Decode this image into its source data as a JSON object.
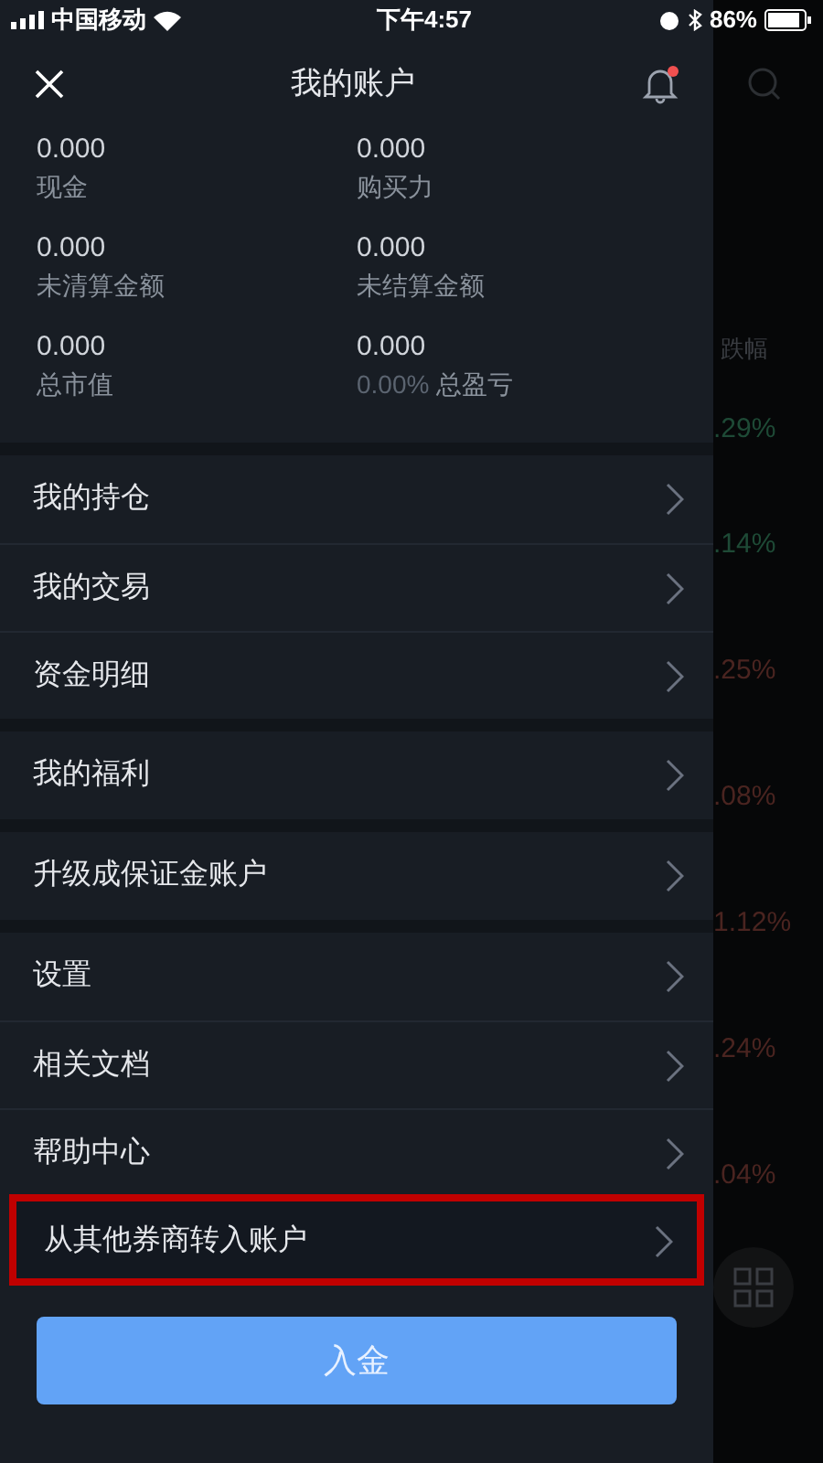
{
  "status_bar": {
    "carrier": "中国移动",
    "time": "下午4:57",
    "battery": "86%"
  },
  "header": {
    "title": "我的账户",
    "notification_unread": true
  },
  "stats": [
    {
      "value": "0.000",
      "label": "现金"
    },
    {
      "value": "0.000",
      "label": "购买力"
    },
    {
      "value": "0.000",
      "label": "未清算金额"
    },
    {
      "value": "0.000",
      "label": "未结算金额"
    },
    {
      "value": "0.000",
      "label": "总市值"
    },
    {
      "value": "0.000",
      "percent": "0.00%",
      "label": "总盈亏"
    }
  ],
  "menu_groups": [
    {
      "items": [
        {
          "label": "我的持仓",
          "highlighted": false
        },
        {
          "label": "我的交易",
          "highlighted": false
        },
        {
          "label": "资金明细",
          "highlighted": false
        }
      ]
    },
    {
      "items": [
        {
          "label": "我的福利",
          "highlighted": false
        }
      ]
    },
    {
      "items": [
        {
          "label": "升级成保证金账户",
          "highlighted": false
        }
      ]
    },
    {
      "items": [
        {
          "label": "设置",
          "highlighted": false
        },
        {
          "label": "相关文档",
          "highlighted": false
        },
        {
          "label": "帮助中心",
          "highlighted": false
        },
        {
          "label": "从其他券商转入账户",
          "highlighted": true
        }
      ]
    }
  ],
  "deposit_button": "入金",
  "background": {
    "column_header": "跌幅",
    "changes": [
      {
        "text": ".29%",
        "color": "#1e4a36"
      },
      {
        "text": ".14%",
        "color": "#1e4a36"
      },
      {
        "text": ".25%",
        "color": "#4a2420"
      },
      {
        "text": ".08%",
        "color": "#4a2420"
      },
      {
        "text": "1.12%",
        "color": "#4a2420"
      },
      {
        "text": ".24%",
        "color": "#4a2420"
      },
      {
        "text": ".04%",
        "color": "#4a2420"
      }
    ]
  }
}
